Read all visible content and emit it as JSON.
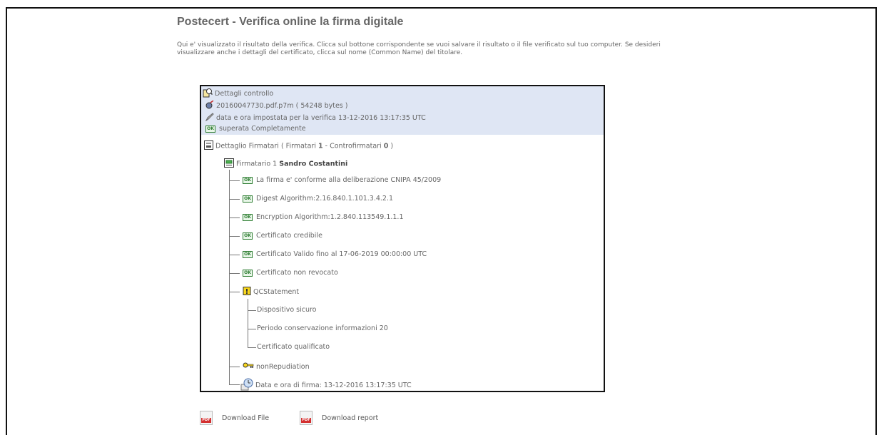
{
  "header": {
    "title": "Postecert - Verifica online la firma digitale",
    "intro_line1": "Qui e' visualizzato il risultato della verifica. Clicca sul bottone corrispondente se vuoi salvare il risultato o il file verificato sul tuo computer. Se desideri",
    "intro_line2": "visualizzare anche i dettagli del certificato, clicca sul nome (Common Name) del titolare."
  },
  "control": {
    "heading": "Dettagli controllo",
    "file": "20160047730.pdf.p7m ( 54248 bytes )",
    "datetime": "data e ora impostata per la verifica 13-12-2016 13:17:35 UTC",
    "result": "superata Completamente"
  },
  "signers": {
    "label_prefix": "Dettaglio Firmatari ( Firmatari ",
    "firmatari_count": "1",
    "mid": " - Controfirmatari ",
    "controfirmatari_count": "0",
    "suffix": " )"
  },
  "signer": {
    "label": "Firmatario 1",
    "name": "Sandro Costantini",
    "checks": [
      "La firma e' conforme alla deliberazione CNIPA 45/2009",
      "Digest Algorithm:2.16.840.1.101.3.4.2.1",
      "Encryption Algorithm:1.2.840.113549.1.1.1",
      "Certificato credibile",
      "Certificato Valido fino al 17-06-2019 00:00:00 UTC",
      "Certificato non revocato"
    ],
    "qc_label": "QCStatement",
    "qc_items": [
      "Dispositivo sicuro",
      "Periodo conservazione informazioni 20",
      "Certificato qualificato"
    ],
    "nonrep": "nonRepudiation",
    "sign_time": "Data e ora di firma: 13-12-2016 13:17:35 UTC"
  },
  "ok_badge": "OK",
  "downloads": {
    "file": "Download File",
    "report": "Download report",
    "icon_tag": "PDF"
  }
}
